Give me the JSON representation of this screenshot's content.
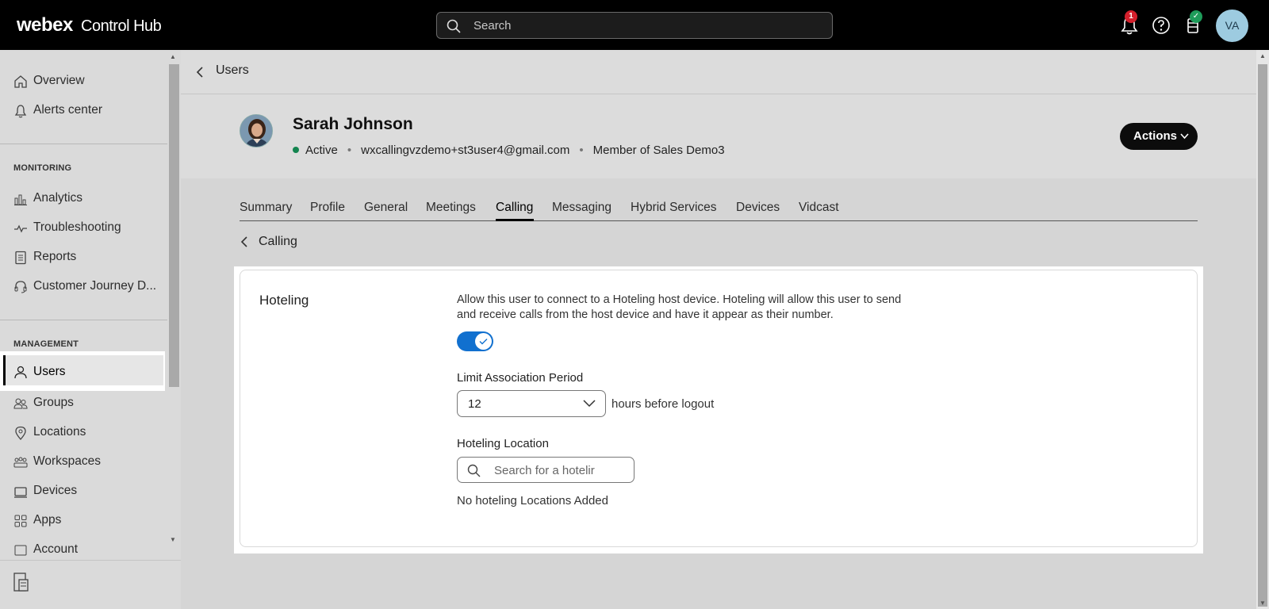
{
  "topbar": {
    "brand_main": "webex",
    "brand_sub": "Control Hub",
    "search_placeholder": "Search",
    "notification_count": "1",
    "avatar_initials": "VA"
  },
  "sidebar": {
    "items_top": [
      {
        "label": "Overview",
        "icon": "home-icon"
      },
      {
        "label": "Alerts center",
        "icon": "bell-icon"
      }
    ],
    "monitoring_header": "MONITORING",
    "items_monitoring": [
      {
        "label": "Analytics",
        "icon": "analytics-icon"
      },
      {
        "label": "Troubleshooting",
        "icon": "pulse-icon"
      },
      {
        "label": "Reports",
        "icon": "report-icon"
      },
      {
        "label": "Customer Journey D...",
        "icon": "headset-icon"
      }
    ],
    "management_header": "MANAGEMENT",
    "items_management": [
      {
        "label": "Users",
        "icon": "user-icon",
        "selected": true
      },
      {
        "label": "Groups",
        "icon": "groups-icon"
      },
      {
        "label": "Locations",
        "icon": "location-icon"
      },
      {
        "label": "Workspaces",
        "icon": "workspaces-icon"
      },
      {
        "label": "Devices",
        "icon": "devices-icon"
      },
      {
        "label": "Apps",
        "icon": "apps-icon"
      },
      {
        "label": "Account",
        "icon": "account-icon"
      }
    ]
  },
  "breadcrumb": {
    "label": "Users"
  },
  "user": {
    "name": "Sarah Johnson",
    "status": "Active",
    "email": "wxcallingvzdemo+st3user4@gmail.com",
    "membership": "Member of Sales Demo3",
    "actions_label": "Actions"
  },
  "tabs": [
    "Summary",
    "Profile",
    "General",
    "Meetings",
    "Calling",
    "Messaging",
    "Hybrid Services",
    "Devices",
    "Vidcast"
  ],
  "active_tab": "Calling",
  "sub_back": {
    "label": "Calling"
  },
  "hoteling": {
    "title": "Hoteling",
    "description": "Allow this user to connect to a Hoteling host device. Hoteling will allow this user to send and receive calls from the host device and have it appear as their number.",
    "enabled": true,
    "limit_label": "Limit Association Period",
    "limit_value": "12",
    "limit_suffix": "hours before logout",
    "location_label": "Hoteling Location",
    "location_placeholder": "Search for a hotelir",
    "empty_text": "No hoteling Locations Added"
  },
  "colors": {
    "accent": "#1170cf",
    "active_dot": "#13844f",
    "badge_red": "#d4202c"
  }
}
